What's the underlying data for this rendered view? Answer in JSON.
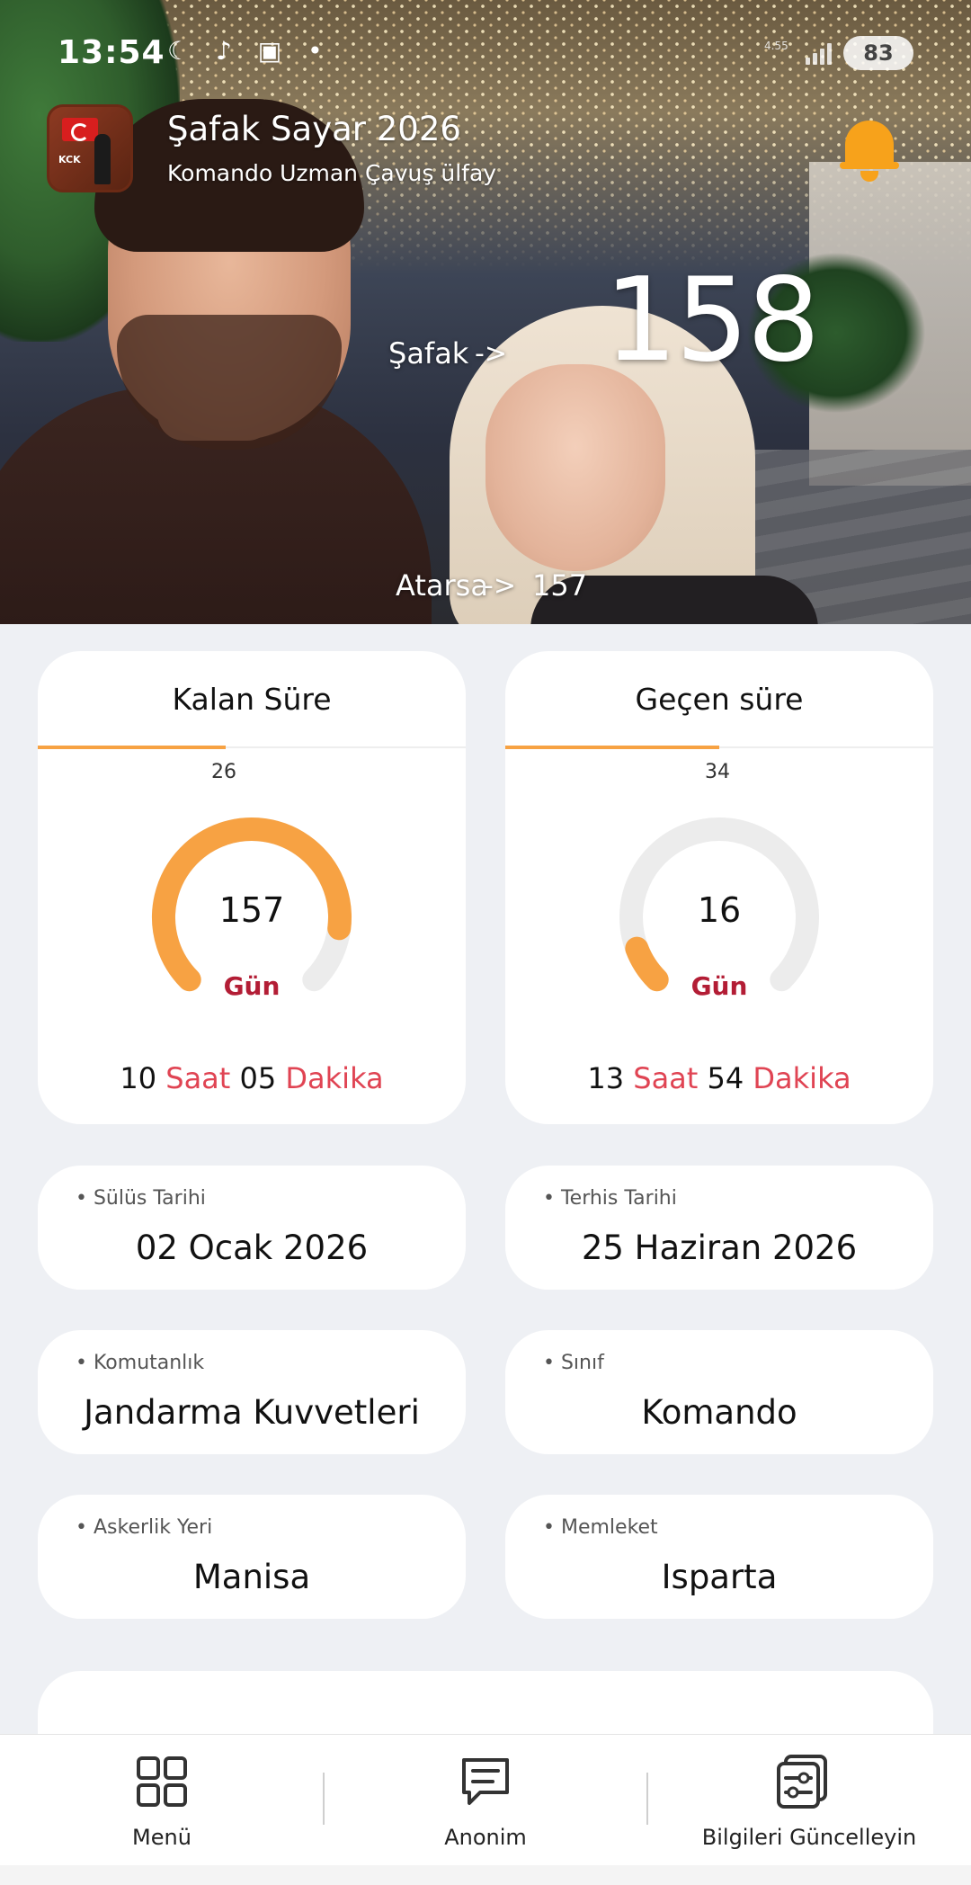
{
  "status_bar": {
    "time": "13:54",
    "icons": "☾ ♪ ▣ •",
    "net_speed": "4.55",
    "battery": "83"
  },
  "header": {
    "title": "Şafak Sayar 2026",
    "subtitle": "Komando Uzman Çavuş ülfay",
    "logo_text": "KCK"
  },
  "hero": {
    "safak_label": "Şafak",
    "safak_arrow": "->",
    "safak_value": "158",
    "atarsa_label": "Atarsa",
    "atarsa_arrow": "->",
    "atarsa_value": "157"
  },
  "remaining": {
    "title": "Kalan Süre",
    "small_number": "26",
    "progress_fraction": 0.44,
    "gauge_fraction": 0.86,
    "value": "157",
    "unit": "Gün",
    "hours": "10",
    "hours_label": "Saat",
    "minutes": "05",
    "minutes_label": "Dakika"
  },
  "elapsed": {
    "title": "Geçen süre",
    "small_number": "34",
    "progress_fraction": 0.5,
    "gauge_fraction": 0.09,
    "value": "16",
    "unit": "Gün",
    "hours": "13",
    "hours_label": "Saat",
    "minutes": "54",
    "minutes_label": "Dakika"
  },
  "info": {
    "enlist_label": "• Sülüs Tarihi",
    "enlist_value": "02 Ocak 2026",
    "discharge_label": "• Terhis Tarihi",
    "discharge_value": "25 Haziran 2026",
    "command_label": "• Komutanlık",
    "command_value": "Jandarma Kuvvetleri",
    "class_label": "• Sınıf",
    "class_value": "Komando",
    "location_label": "• Askerlik Yeri",
    "location_value": "Manisa",
    "hometown_label": "• Memleket",
    "hometown_value": "Isparta"
  },
  "nav": {
    "menu": "Menü",
    "anon": "Anonim",
    "update": "Bilgileri Güncelleyin"
  },
  "colors": {
    "accent_orange": "#f7a243",
    "gauge_track": "#ececec",
    "unit_red": "#b31d35",
    "accent_red": "#e04453",
    "bell": "#f7a21b"
  }
}
